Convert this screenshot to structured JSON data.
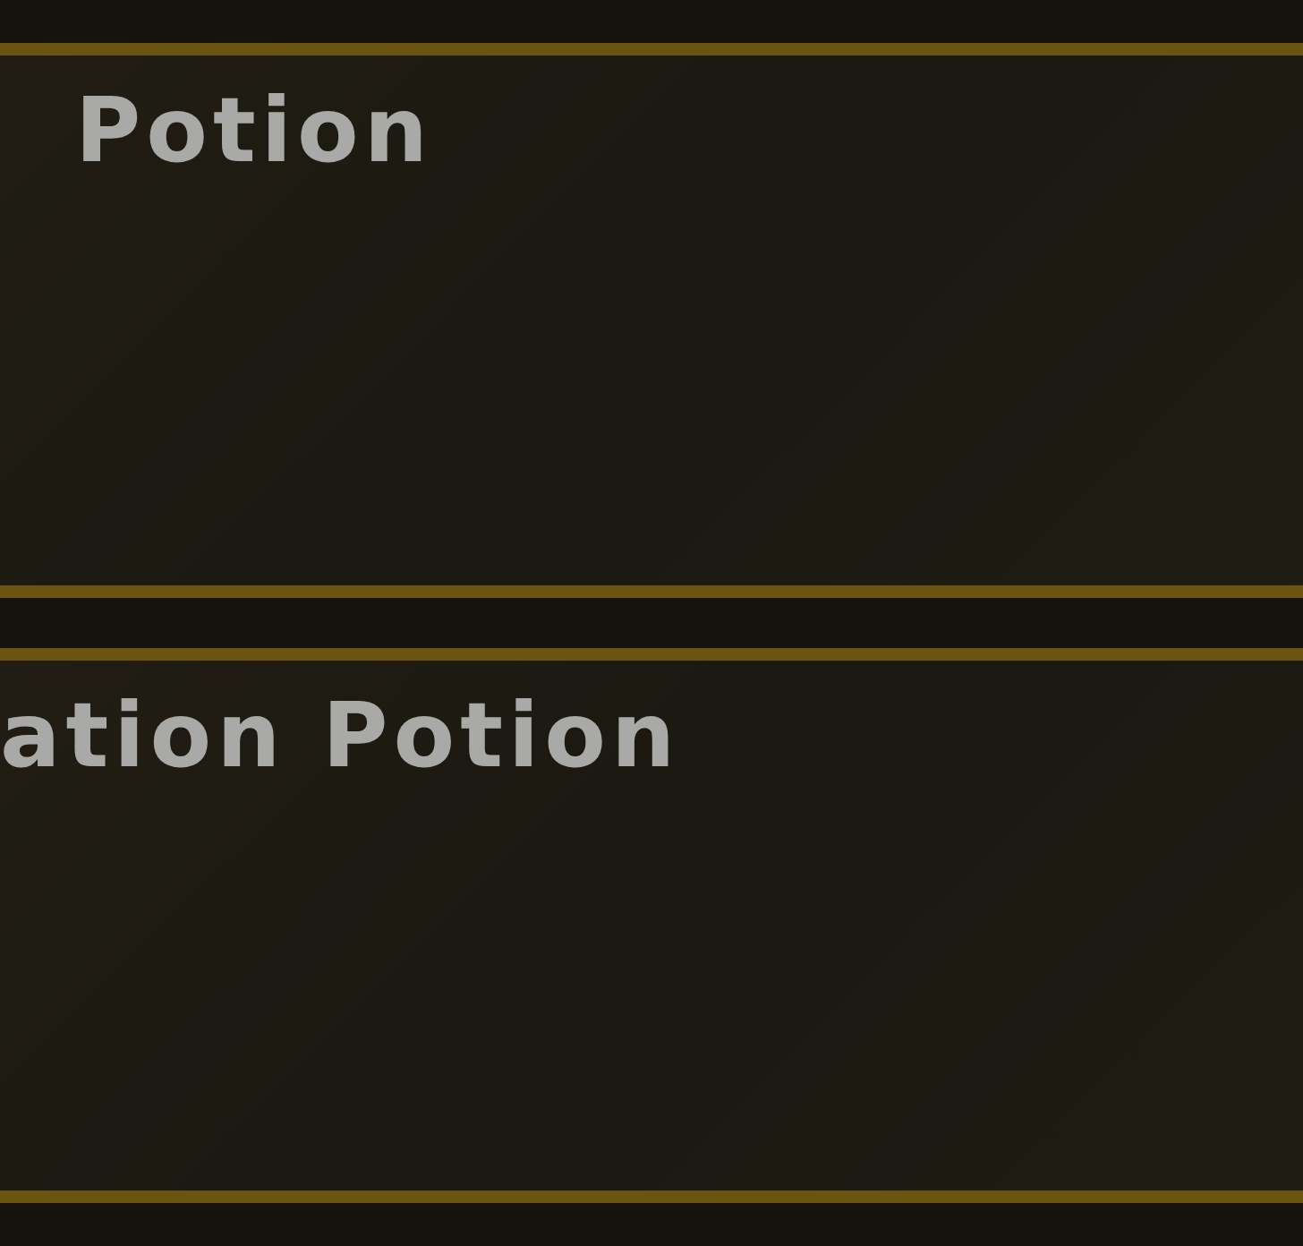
{
  "items": [
    {
      "title": "Potion",
      "kind": "indented"
    },
    {
      "title": "ation Potion",
      "kind": "flush"
    }
  ]
}
